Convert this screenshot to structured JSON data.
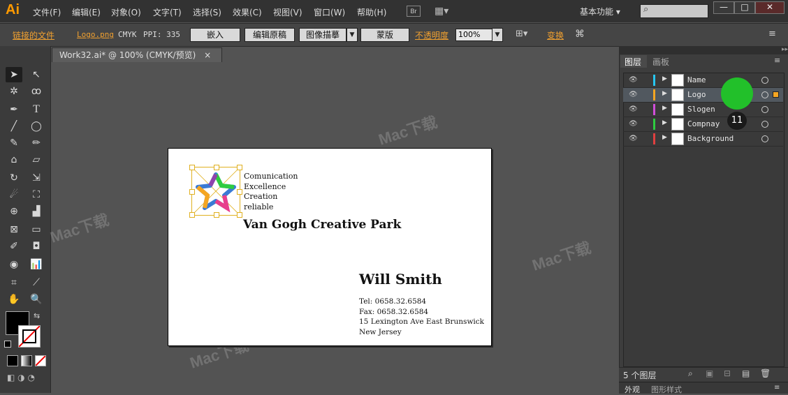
{
  "app": {
    "logo": "Ai",
    "menu": [
      "文件(F)",
      "编辑(E)",
      "对象(O)",
      "文字(T)",
      "选择(S)",
      "效果(C)",
      "视图(V)",
      "窗口(W)",
      "帮助(H)"
    ],
    "bridge_label": "Br",
    "workspace": "基本功能",
    "window_controls": {
      "minimize": "—",
      "maximize": "□",
      "close": "✕"
    }
  },
  "control_bar": {
    "linked_file_label": "链接的文件",
    "filename": "Logo.png",
    "color_mode": "CMYK",
    "ppi": "PPI: 335",
    "embed": "嵌入",
    "edit_original": "编辑原稿",
    "image_trace": "图像描摹",
    "mask": "蒙版",
    "opacity_label": "不透明度",
    "opacity_value": "100%",
    "transform_label": "变换"
  },
  "document": {
    "tab_title": "Work32.ai* @ 100% (CMYK/预览)",
    "close_icon": "×"
  },
  "card": {
    "tagline": [
      "Comunication",
      "Excellence",
      "Creation",
      "reliable"
    ],
    "company": "Van Gogh Creative Park",
    "person": "Will Smith",
    "tel": "Tel: 0658.32.6584",
    "fax": "Fax: 0658.32.6584",
    "address1": "15 Lexington Ave East Brunswick",
    "address2": "New Jersey"
  },
  "layers_panel": {
    "tabs": [
      "图层",
      "画板"
    ],
    "layers": [
      {
        "name": "Name",
        "color": "#27c6f0"
      },
      {
        "name": "Logo",
        "color": "#f5a623"
      },
      {
        "name": "Slogen",
        "color": "#d04fd8"
      },
      {
        "name": "Compnay",
        "color": "#2ecc40"
      },
      {
        "name": "Background",
        "color": "#e04040"
      }
    ],
    "active_layer": "Logo",
    "layer_count": "5 个图层",
    "callout_number": "11",
    "bottom_tabs": [
      "外观",
      "图形样式"
    ]
  },
  "watermark": "Mac下载"
}
